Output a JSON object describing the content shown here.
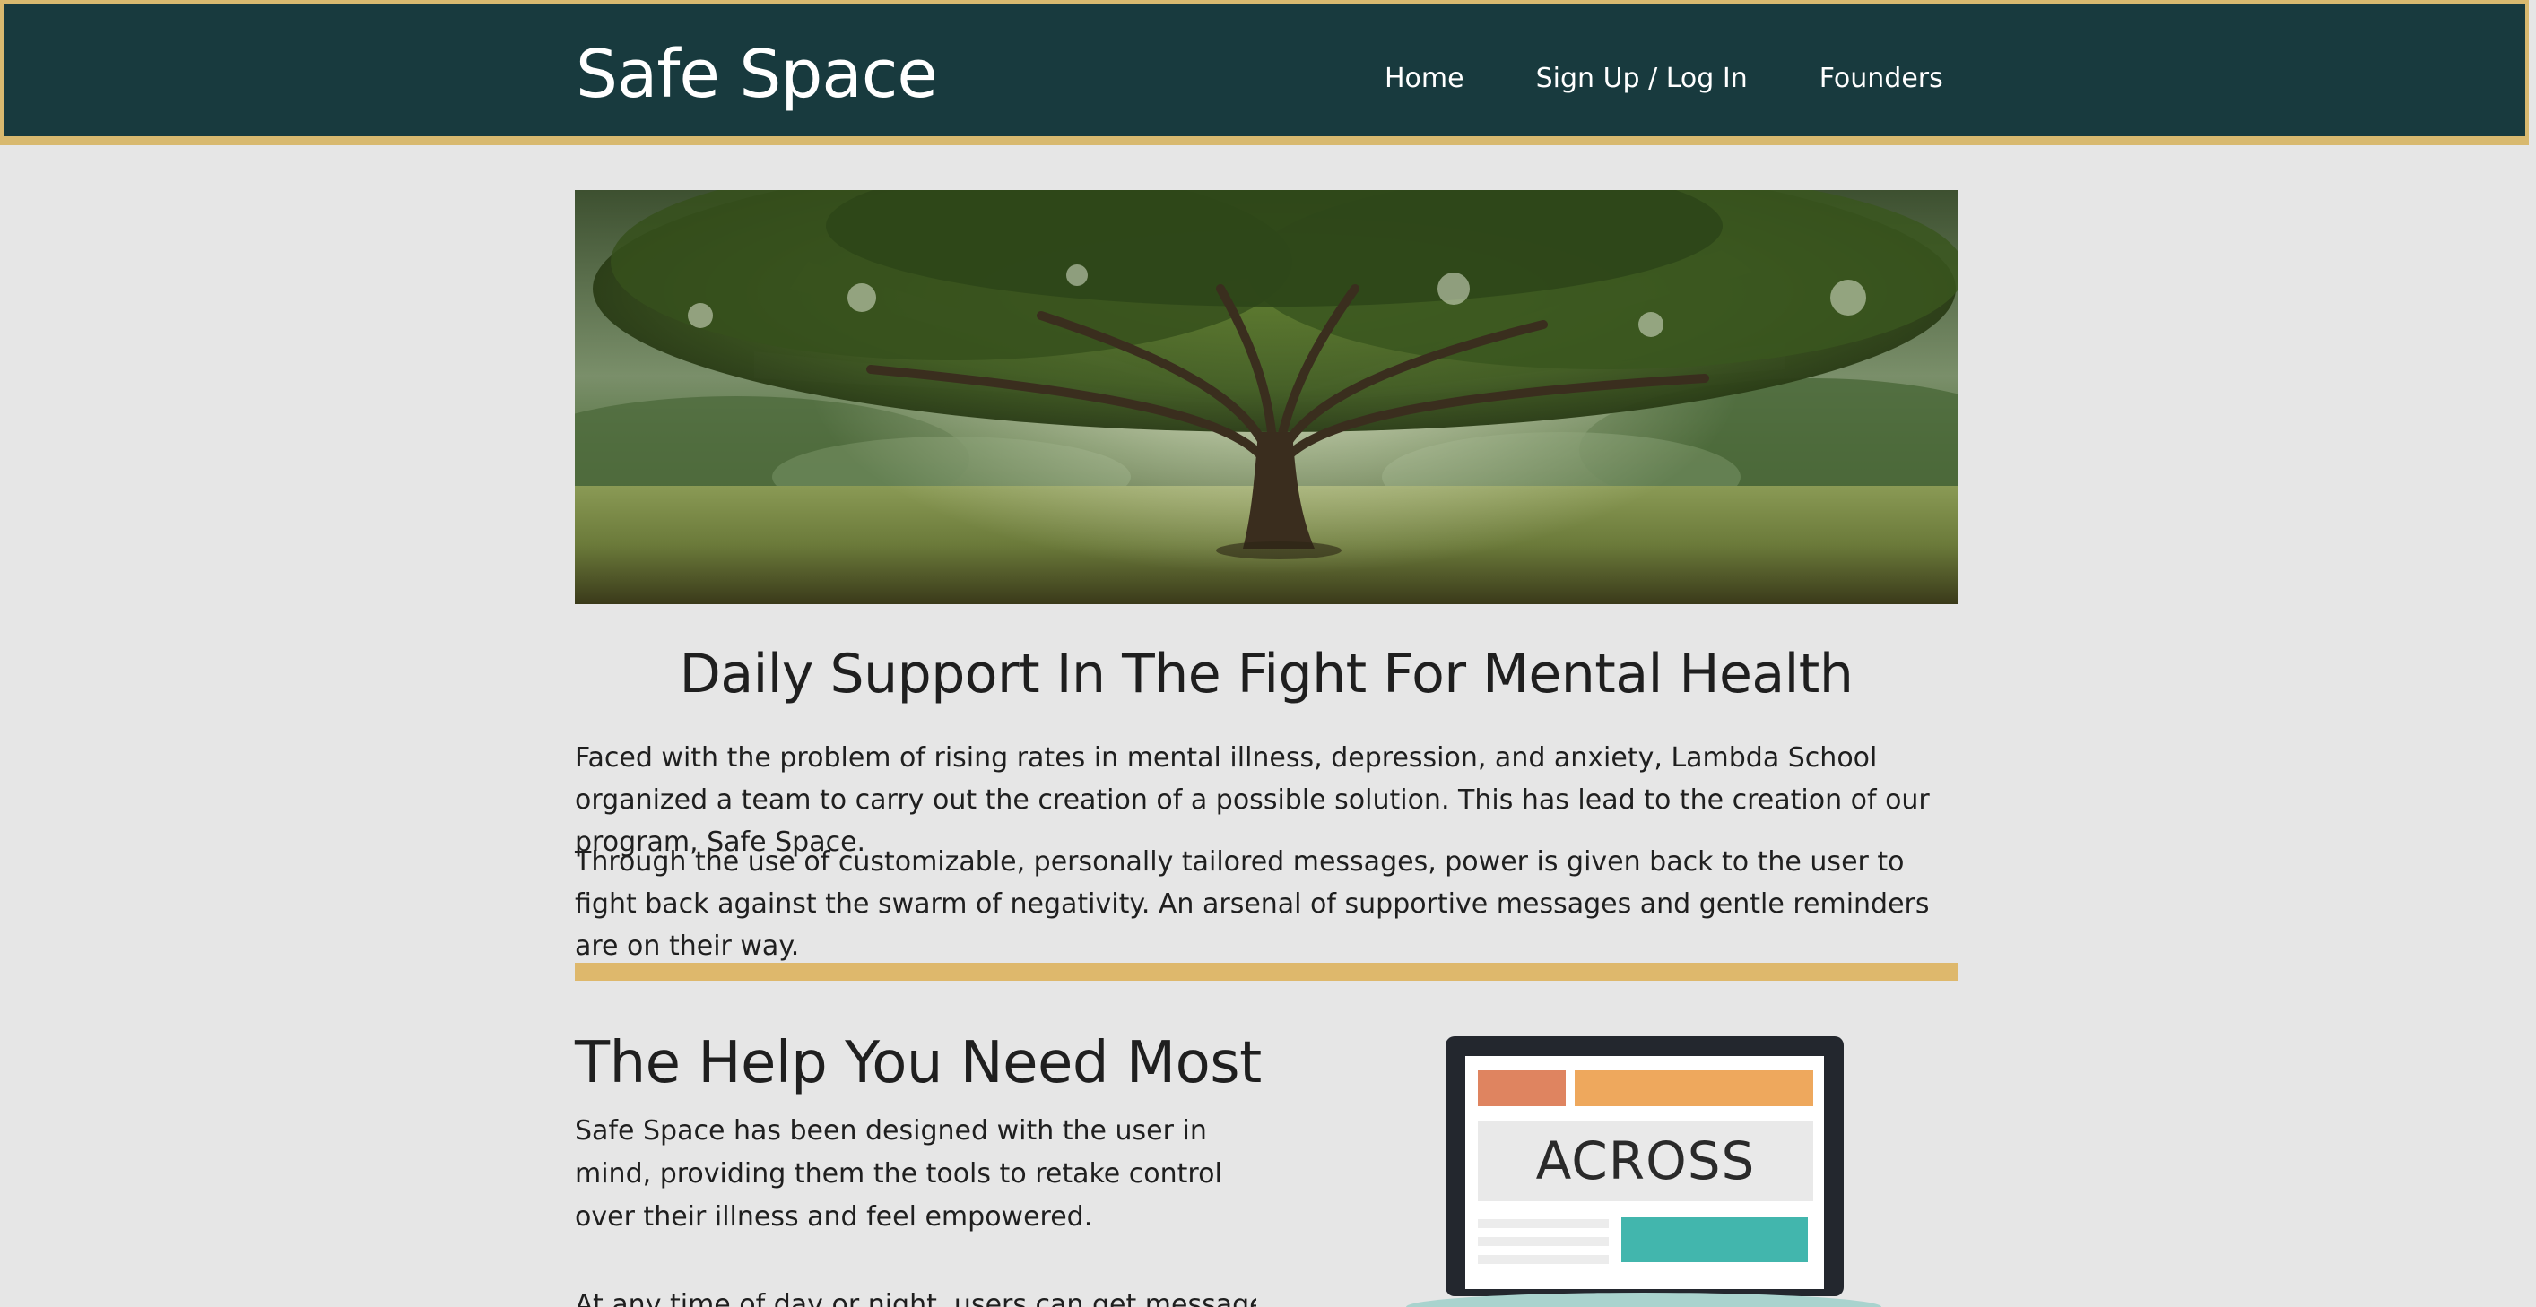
{
  "header": {
    "brand": "Safe Space",
    "nav": [
      {
        "label": "Home"
      },
      {
        "label": "Sign Up / Log In"
      },
      {
        "label": "Founders"
      }
    ]
  },
  "hero": {
    "image_subject": "large tree in a sunlit meadow"
  },
  "intro": {
    "title": "Daily Support In The Fight For Mental Health",
    "paragraphs": [
      "Faced with the problem of rising rates in mental illness, depression, and anxiety, Lambda School organized a team to carry out the creation of a possible solution. This has lead to the creation of our program, Safe Space.",
      "Through the use of customizable, personally tailored messages, power is given back to the user to fight back against the swarm of negativity. An arsenal of supportive messages and gentle reminders are on their way."
    ]
  },
  "help": {
    "title": "The Help You Need Most",
    "paragraph": "Safe Space has been designed with the user in mind, providing them the tools to retake control over their illness and feel empowered.",
    "paragraph2": "At any time of day or night, users can get messages while"
  },
  "illustration": {
    "icon": "laptop-icon",
    "screen_text": "ACROSS"
  },
  "colors": {
    "header_bg": "#183a3e",
    "accent_gold": "#deb86c",
    "page_bg": "#e6e6e6",
    "text": "#1f1f1f"
  }
}
